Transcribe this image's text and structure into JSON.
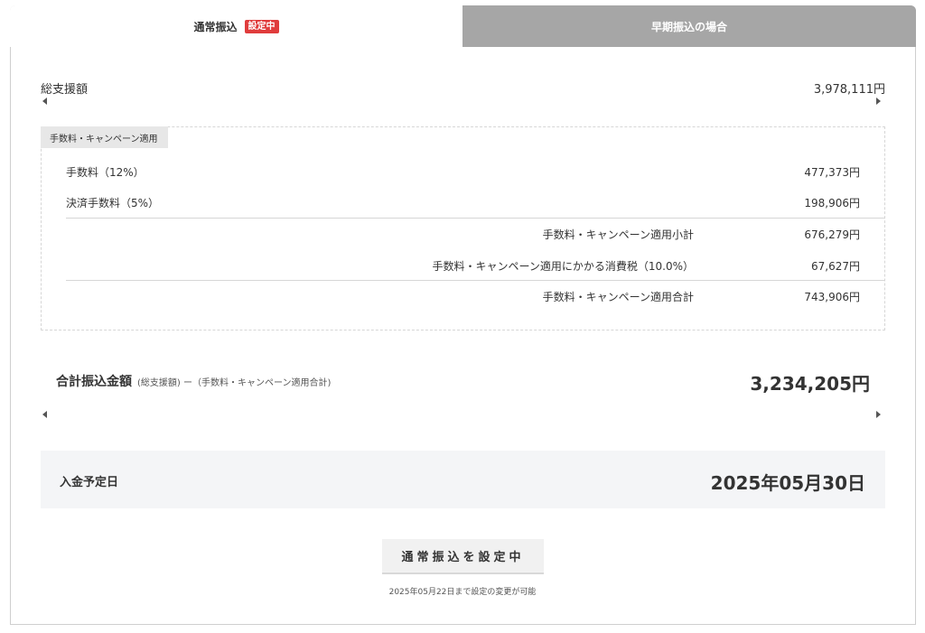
{
  "tabs": {
    "normal_label": "通常振込",
    "normal_badge": "設定中",
    "early_label": "早期振込の場合"
  },
  "summary": {
    "total_support_label": "総支援額",
    "total_support_value": "3,978,111円"
  },
  "fees": {
    "section_label": "手数料・キャンペーン適用",
    "fee_label": "手数料（12%）",
    "fee_value": "477,373円",
    "settlement_label": "決済手数料（5%）",
    "settlement_value": "198,906円",
    "subtotal_label": "手数料・キャンペーン適用小計",
    "subtotal_value": "676,279円",
    "tax_label": "手数料・キャンペーン適用にかかる消費税（10.0%）",
    "tax_value": "67,627円",
    "total_label": "手数料・キャンペーン適用合計",
    "total_value": "743,906円"
  },
  "transfer": {
    "label": "合計振込金額",
    "sub": "(総支援額) ー（手数料・キャンペーン適用合計)",
    "value": "3,234,205円"
  },
  "deposit": {
    "label": "入金予定日",
    "value": "2025年05月30日"
  },
  "action": {
    "button_label": "通常振込を設定中",
    "note": "2025年05月22日まで設定の変更が可能"
  }
}
